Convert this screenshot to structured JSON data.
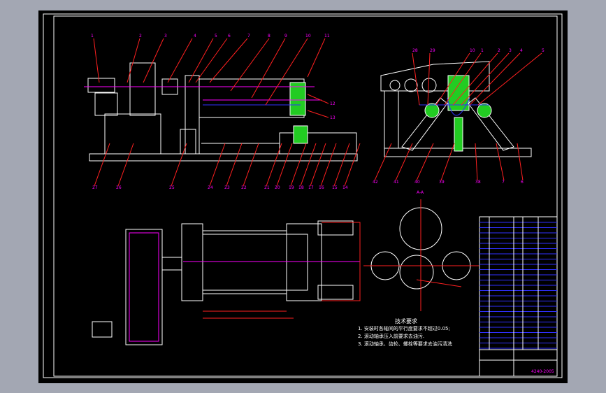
{
  "drawing": {
    "front_view_labels_top": [
      "1",
      "2",
      "3",
      "4",
      "5",
      "6",
      "7",
      "8",
      "9",
      "10",
      "11"
    ],
    "front_view_labels_right": [
      "12",
      "13"
    ],
    "front_view_labels_bottom": [
      "27",
      "26",
      "25",
      "24",
      "23",
      "22",
      "21",
      "20",
      "19",
      "18",
      "17",
      "16",
      "15",
      "14"
    ],
    "side_view_labels_top": [
      "28",
      "29",
      "10",
      "1",
      "2",
      "3",
      "4",
      "5"
    ],
    "side_view_labels_bottom": [
      "42",
      "41",
      "40",
      "39",
      "38",
      "7",
      "6"
    ],
    "section_label": "A-A",
    "tech_requirements": {
      "title": "技术要求",
      "items": [
        "1. 安装时各轴间的平行度要求不超过0.05;",
        "2. 滚动轴承压入前要求去油污.",
        "3. 滚动轴承、齿轮、螺栓等要求去油污清洗"
      ]
    },
    "title_block": {
      "drawing_no": "4240-2005"
    },
    "colors": {
      "background": "#000000",
      "outline": "#ffffff",
      "leader": "#ff2020",
      "label": "#ff00ff",
      "section_fill": "#22cc22",
      "centerline": "#3030ff"
    }
  }
}
